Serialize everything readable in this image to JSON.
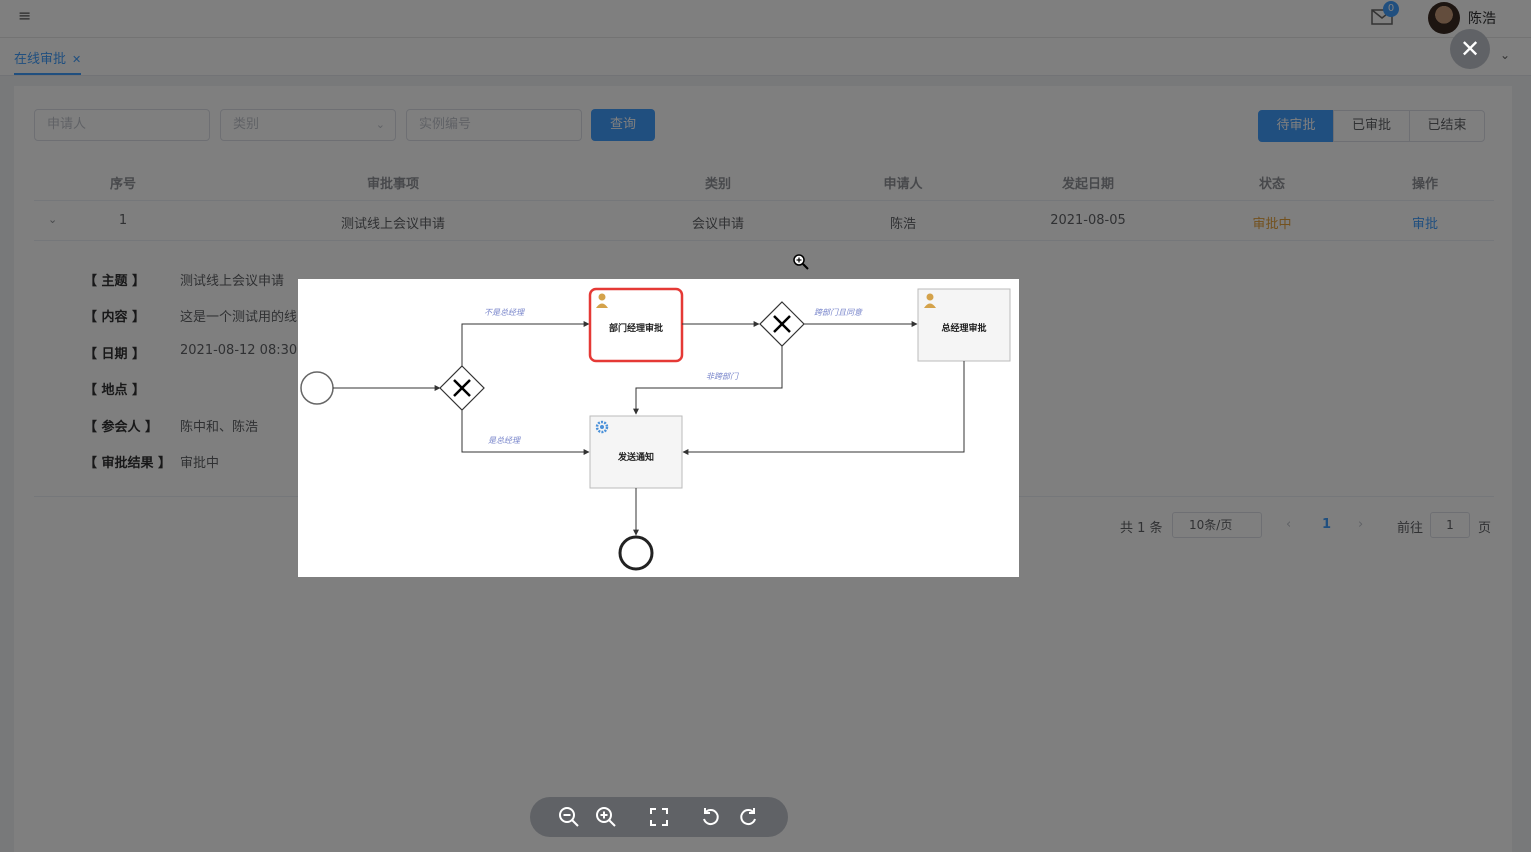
{
  "header": {
    "menu_icon": "hamburger-icon",
    "mail_icon": "mail-icon",
    "mail_badge": "0",
    "user_name": "陈浩"
  },
  "tabs": [
    {
      "label": "在线审批",
      "active": true
    }
  ],
  "filters": {
    "applicant_placeholder": "申请人",
    "category_placeholder": "类别",
    "instance_placeholder": "实例编号",
    "query_label": "查询"
  },
  "status_segments": [
    {
      "label": "待审批",
      "active": true
    },
    {
      "label": "已审批",
      "active": false
    },
    {
      "label": "已结束",
      "active": false
    }
  ],
  "table": {
    "columns": [
      "序号",
      "审批事项",
      "类别",
      "申请人",
      "发起日期",
      "状态",
      "操作"
    ],
    "rows": [
      {
        "index": "1",
        "item": "测试线上会议申请",
        "category": "会议申请",
        "applicant": "陈浩",
        "date": "2021-08-05",
        "status": "审批中",
        "action": "审批"
      }
    ]
  },
  "detail": [
    {
      "key": "【   主题   】",
      "value": "测试线上会议申请"
    },
    {
      "key": "【   内容   】",
      "value": "这是一个测试用的线"
    },
    {
      "key": "【   日期   】",
      "value": "2021-08-12   08:30"
    },
    {
      "key": "【   地点   】",
      "value": ""
    },
    {
      "key": "【  参会人  】",
      "value": "陈中和、陈浩"
    },
    {
      "key": "【 审批结果 】",
      "value": "审批中"
    }
  ],
  "pagination": {
    "total": "共 1 条",
    "page_size": "10条/页",
    "current_page": "1",
    "goto_label": "前往",
    "goto_value": "1",
    "page_unit": "页"
  },
  "viewer": {
    "close_icon": "close-icon",
    "toolbar": [
      "zoom-out-icon",
      "zoom-in-icon",
      "fit-screen-icon",
      "rotate-left-icon",
      "rotate-right-icon"
    ]
  },
  "diagram": {
    "tasks": {
      "dept_manager": "部门经理审批",
      "general_manager": "总经理审批",
      "send_notice": "发送通知"
    },
    "flows": {
      "not_gm": "不是总经理",
      "is_gm": "是总经理",
      "cross_dept_agree": "跨部门且同意",
      "non_cross_dept": "非跨部门"
    },
    "active_color": "#e53935"
  }
}
